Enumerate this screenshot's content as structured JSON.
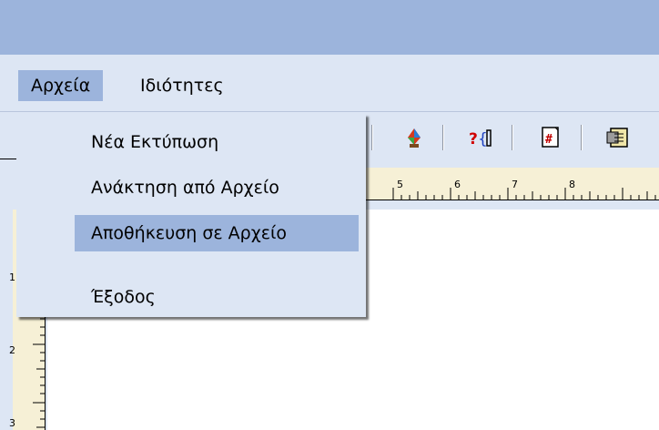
{
  "menubar": {
    "items": [
      {
        "label": "Αρχεία",
        "active": true
      },
      {
        "label": "Ιδιότητες",
        "active": false
      }
    ]
  },
  "dropdown": {
    "items": [
      {
        "label": "Νέα Εκτύπωση",
        "highlighted": false
      },
      {
        "label": "Ανάκτηση από Αρχείο",
        "highlighted": false
      },
      {
        "label": "Αποθήκευση σε Αρχείο",
        "highlighted": true
      },
      {
        "label": "Έξοδος",
        "highlighted": false
      }
    ]
  },
  "toolbar": {
    "icons": [
      "paint-bucket-icon",
      "help-cursor-icon",
      "hash-page-icon",
      "properties-icon"
    ]
  },
  "rulers": {
    "horizontal_numbers": [
      "5",
      "6",
      "7",
      "8"
    ],
    "vertical_numbers": [
      "1",
      "2",
      "3"
    ]
  },
  "colors": {
    "title_bar": "#9cb4dc",
    "menu_background": "#dde6f4",
    "highlight": "#9cb4dc",
    "ruler": "#f6f0d6"
  }
}
